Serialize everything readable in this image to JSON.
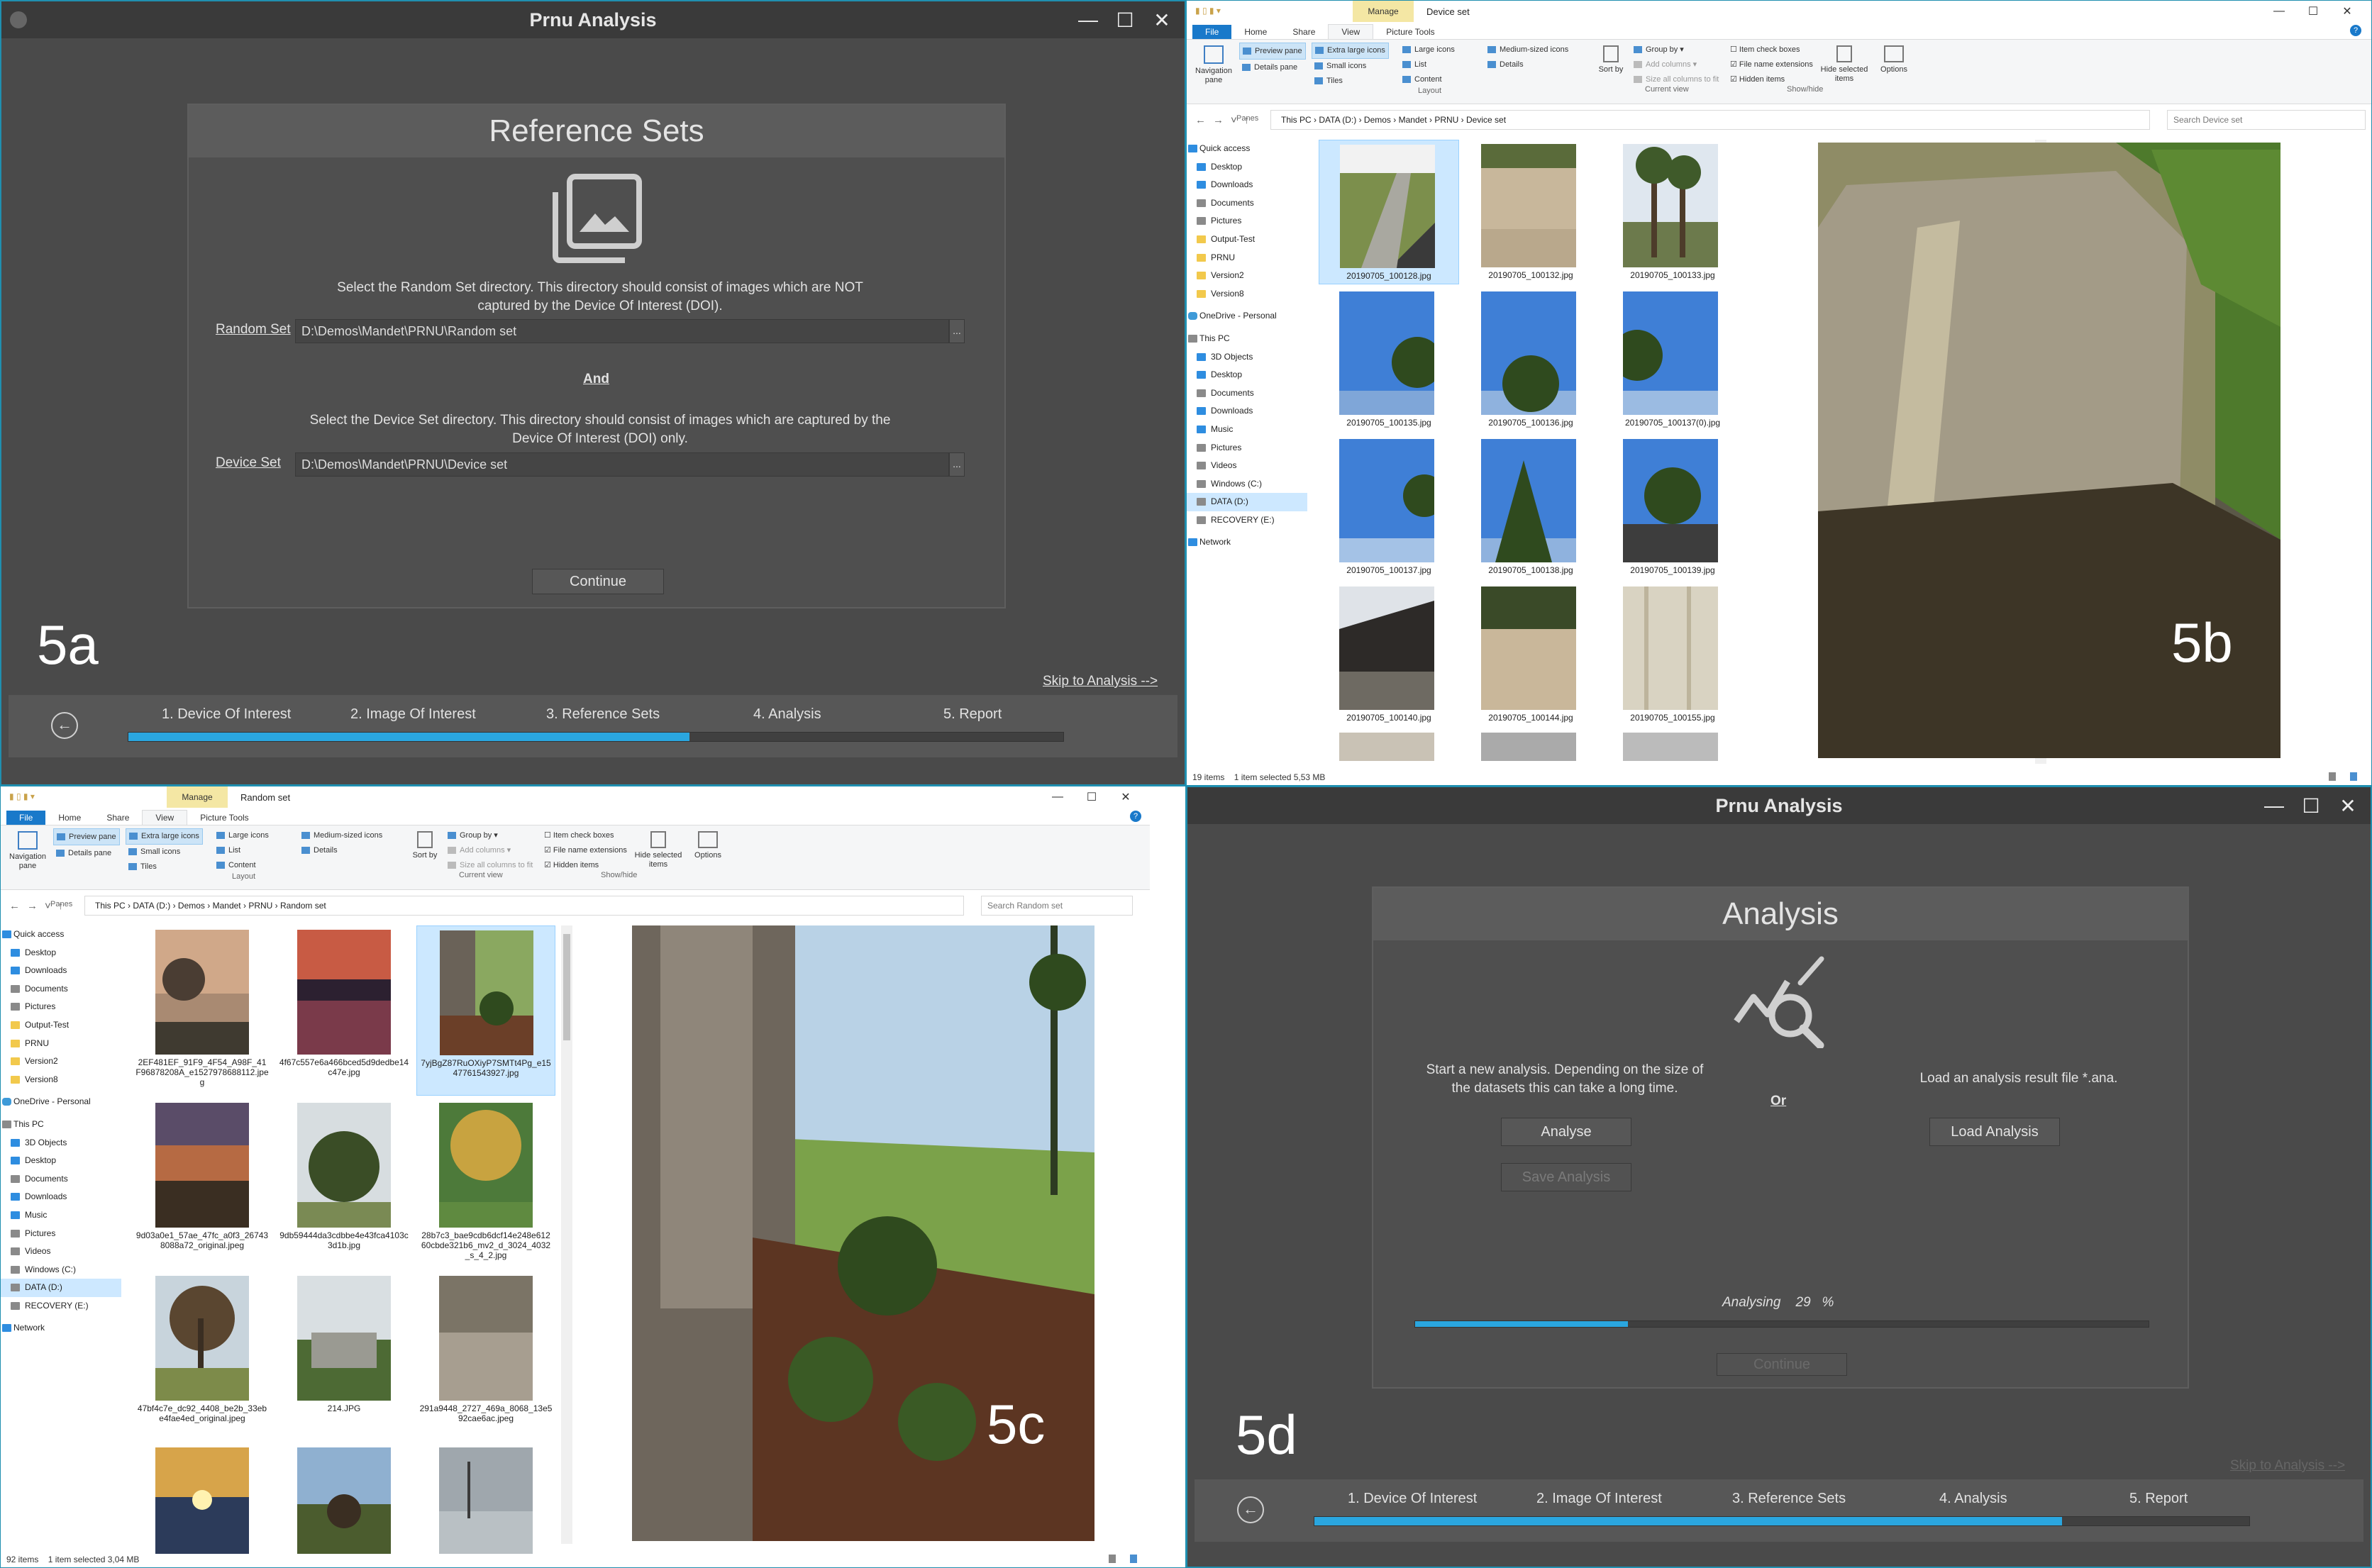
{
  "q5a": {
    "window_title": "Prnu Analysis",
    "window_controls": [
      "—",
      "☐",
      "✕"
    ],
    "panel_title": "Reference Sets",
    "random_desc": "Select the Random Set directory. This directory should consist of images which are NOT captured by the Device Of Interest (DOI).",
    "random_label": "Random Set",
    "random_value": "D:\\Demos\\Mandet\\PRNU\\Random set",
    "and_label": "And",
    "device_desc": "Select the Device Set directory. This directory should consist of images which are captured by the Device Of Interest (DOI) only.",
    "device_label": "Device Set",
    "device_value": "D:\\Demos\\Mandet\\PRNU\\Device set",
    "browse_label": "...",
    "continue_label": "Continue",
    "skip_label": "Skip to Analysis -->",
    "overlay_label": "5a",
    "steps": [
      "1. Device Of Interest",
      "2. Image Of Interest",
      "3. Reference Sets",
      "4. Analysis",
      "5. Report"
    ],
    "progress": 0.6
  },
  "q5b": {
    "manage_tab": "Manage",
    "window_title": "Device set",
    "tabs": [
      "File",
      "Home",
      "Share",
      "View",
      "Picture Tools"
    ],
    "ribbon": {
      "nav_pane": "Navigation pane",
      "preview_pane": "Preview pane",
      "details_pane": "Details pane",
      "extra_large": "Extra large icons",
      "large": "Large icons",
      "medium": "Medium-sized icons",
      "small": "Small icons",
      "list": "List",
      "details": "Details",
      "tiles": "Tiles",
      "content": "Content",
      "sort_by": "Sort by",
      "group_by": "Group by",
      "add_columns": "Add columns",
      "size_all": "Size all columns to fit",
      "item_check": "Item check boxes",
      "file_ext": "File name extensions",
      "hidden": "Hidden items",
      "hide_selected": "Hide selected items",
      "options": "Options",
      "groups": [
        "Panes",
        "Layout",
        "Current view",
        "Show/hide"
      ]
    },
    "breadcrumb": [
      "This PC",
      "DATA (D:)",
      "Demos",
      "Mandet",
      "PRNU",
      "Device set"
    ],
    "search_placeholder": "Search Device set",
    "tree": [
      "Quick access",
      "Desktop",
      "Downloads",
      "Documents",
      "Pictures",
      "Output-Test",
      "PRNU",
      "Version2",
      "Version8",
      "OneDrive - Personal",
      "This PC",
      "3D Objects",
      "Desktop",
      "Documents",
      "Downloads",
      "Music",
      "Pictures",
      "Videos",
      "Windows (C:)",
      "DATA (D:)",
      "RECOVERY (E:)",
      "Network"
    ],
    "files": [
      "20190705_100128.jpg",
      "20190705_100132.jpg",
      "20190705_100133.jpg",
      "20190705_100135.jpg",
      "20190705_100136.jpg",
      "20190705_100137(0).jpg",
      "20190705_100137.jpg",
      "20190705_100138.jpg",
      "20190705_100139.jpg",
      "20190705_100140.jpg",
      "20190705_100144.jpg",
      "20190705_100155.jpg"
    ],
    "status_items": "19 items",
    "status_selected": "1 item selected  5,53 MB",
    "overlay_label": "5b"
  },
  "q5c": {
    "manage_tab": "Manage",
    "window_title": "Random set",
    "breadcrumb": [
      "This PC",
      "DATA (D:)",
      "Demos",
      "Mandet",
      "PRNU",
      "Random set"
    ],
    "search_placeholder": "Search Random set",
    "files": [
      "2EF481EF_91F9_4F54_A98F_41F96878208A_e1527978688112.jpeg",
      "4f67c557e6a466bced5d9dedbe14c47e.jpg",
      "7yjBgZ87RuOXiyP7SMTt4Pg_e1547761543927.jpg",
      "9d03a0e1_57ae_47fc_a0f3_267438088a72_original.jpeg",
      "9db59444da3cdbbe4e43fca4103c3d1b.jpg",
      "28b7c3_bae9cdb6dcf14e248e61260cbde321b6_mv2_d_3024_4032_s_4_2.jpg",
      "47bf4c7e_dc92_4408_be2b_33ebe4fae4ed_original.jpeg",
      "214.JPG",
      "291a9448_2727_469a_8068_13e592cae6ac.jpeg"
    ],
    "status_items": "92 items",
    "status_selected": "1 item selected  3,04 MB",
    "overlay_label": "5c"
  },
  "q5d": {
    "window_title": "Prnu Analysis",
    "panel_title": "Analysis",
    "start_desc": "Start a new analysis. Depending on the size of the datasets this can take a long time.",
    "or_label": "Or",
    "load_desc": "Load an analysis result file *.ana.",
    "analyse_label": "Analyse",
    "load_label": "Load Analysis",
    "save_label": "Save Analysis",
    "analysing_label": "Analysing",
    "analysing_value": "29",
    "analysing_unit": "%",
    "analysis_progress": 0.29,
    "continue_label": "Continue",
    "skip_label": "Skip to Analysis -->",
    "overlay_label": "5d",
    "steps": [
      "1. Device Of Interest",
      "2. Image Of Interest",
      "3. Reference Sets",
      "4. Analysis",
      "5. Report"
    ],
    "progress": 0.8
  }
}
